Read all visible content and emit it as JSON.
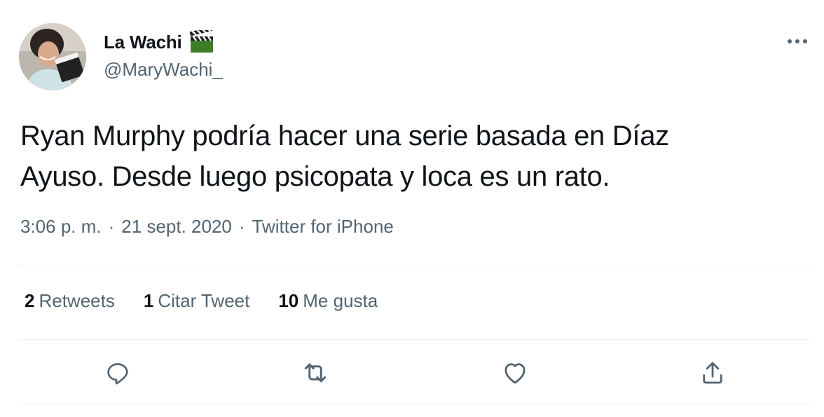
{
  "user": {
    "display_name": "La Wachi",
    "emoji": "clapper-board-emoji",
    "handle": "@MaryWachi_"
  },
  "tweet": {
    "text_line1": "Ryan Murphy podría hacer una serie basada en Díaz",
    "text_line2": "Ayuso. Desde luego psicopata y loca es un rato.",
    "time": "3:06 p. m.",
    "date": "21 sept. 2020",
    "separator": "·",
    "source": "Twitter for iPhone"
  },
  "stats": [
    {
      "count": "2",
      "label": "Retweets"
    },
    {
      "count": "1",
      "label": "Citar Tweet"
    },
    {
      "count": "10",
      "label": "Me gusta"
    }
  ],
  "actions": {
    "reply": "reply-icon",
    "retweet": "retweet-icon",
    "like": "heart-icon",
    "share": "share-icon"
  },
  "colors": {
    "text": "#0f1419",
    "secondary": "#536471",
    "divider": "#eff3f4"
  }
}
